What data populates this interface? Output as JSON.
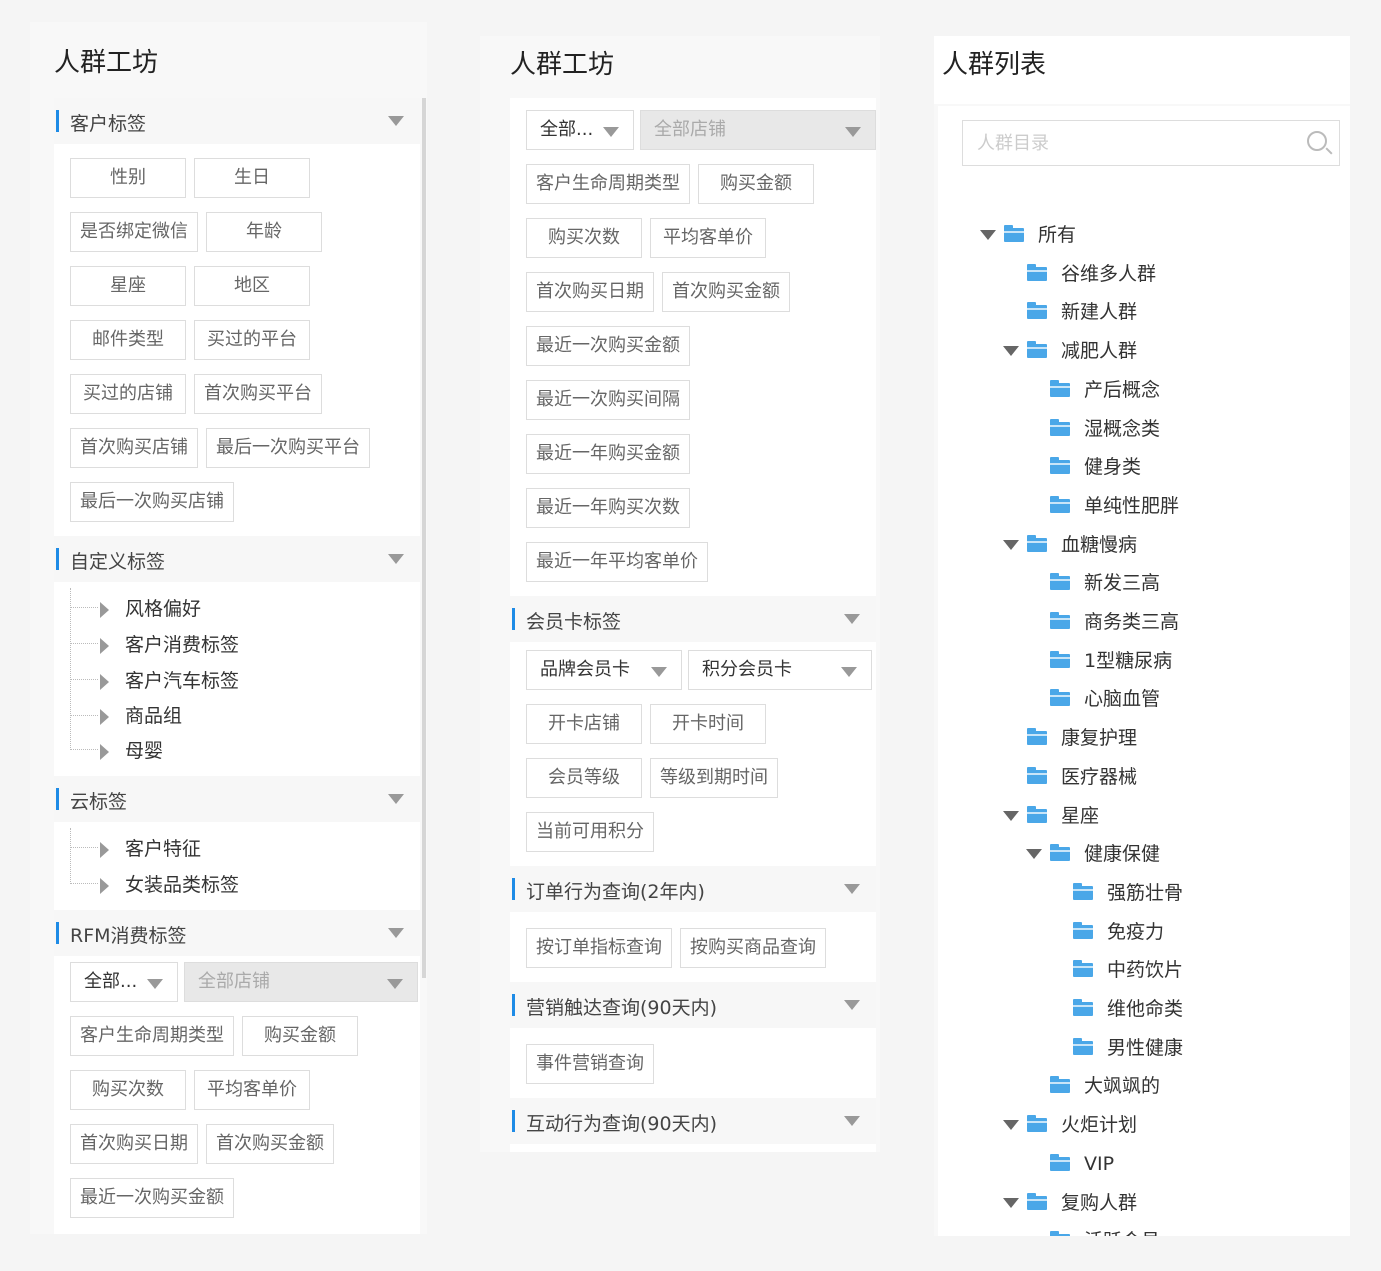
{
  "panel1": {
    "title": "人群工坊",
    "sections": [
      {
        "label": "客户标签"
      },
      {
        "label": "自定义标签"
      },
      {
        "label": "云标签"
      },
      {
        "label": "RFM消费标签"
      }
    ],
    "customer_tags": [
      "性别",
      "生日",
      "是否绑定微信",
      "年龄",
      "星座",
      "地区",
      "邮件类型",
      "买过的平台",
      "买过的店铺",
      "首次购买平台",
      "首次购买店铺",
      "最后一次购买平台",
      "最后一次购买店铺"
    ],
    "custom_tree": [
      "风格偏好",
      "客户消费标签",
      "客户汽车标签",
      "商品组",
      "母婴"
    ],
    "cloud_tree": [
      "客户特征",
      "女装品类标签"
    ],
    "rfm_select_all": "全部...",
    "rfm_select_store": "全部店铺",
    "rfm_tags": [
      "客户生命周期类型",
      "购买金额",
      "购买次数",
      "平均客单价",
      "首次购买日期",
      "首次购买金额",
      "最近一次购买金额"
    ]
  },
  "panel2": {
    "title": "人群工坊",
    "select_all": "全部...",
    "select_store": "全部店铺",
    "rfm_tags": [
      "客户生命周期类型",
      "购买金额",
      "购买次数",
      "平均客单价",
      "首次购买日期",
      "首次购买金额",
      "最近一次购买金额",
      "最近一次购买间隔",
      "最近一年购买金额",
      "最近一年购买次数",
      "最近一年平均客单价"
    ],
    "sections": [
      {
        "label": "会员卡标签"
      },
      {
        "label": "订单行为查询(2年内)"
      },
      {
        "label": "营销触达查询(90天内)"
      },
      {
        "label": "互动行为查询(90天内)"
      }
    ],
    "member_selects": [
      "品牌会员卡",
      "积分会员卡"
    ],
    "member_tags": [
      "开卡店铺",
      "开卡时间",
      "会员等级",
      "等级到期时间",
      "当前可用积分"
    ],
    "order_tags": [
      "按订单指标查询",
      "按购买商品查询"
    ],
    "marketing_tags": [
      "事件营销查询"
    ]
  },
  "panel3": {
    "title": "人群列表",
    "search_placeholder": "人群目录",
    "tree": [
      {
        "label": "所有",
        "level": 0,
        "expanded": true
      },
      {
        "label": "谷维多人群",
        "level": 1
      },
      {
        "label": "新建人群",
        "level": 1
      },
      {
        "label": "减肥人群",
        "level": 1,
        "expanded": true
      },
      {
        "label": "产后概念",
        "level": 2
      },
      {
        "label": "湿概念类",
        "level": 2
      },
      {
        "label": "健身类",
        "level": 2
      },
      {
        "label": "单纯性肥胖",
        "level": 2
      },
      {
        "label": "血糖慢病",
        "level": 1,
        "expanded": true
      },
      {
        "label": "新发三高",
        "level": 2
      },
      {
        "label": "商务类三高",
        "level": 2
      },
      {
        "label": "1型糖尿病",
        "level": 2
      },
      {
        "label": "心脑血管",
        "level": 2
      },
      {
        "label": "康复护理",
        "level": 1
      },
      {
        "label": "医疗器械",
        "level": 1
      },
      {
        "label": "星座",
        "level": 1,
        "expanded": true
      },
      {
        "label": "健康保健",
        "level": 2,
        "expanded": true
      },
      {
        "label": "强筋壮骨",
        "level": 3
      },
      {
        "label": "免疫力",
        "level": 3
      },
      {
        "label": "中药饮片",
        "level": 3
      },
      {
        "label": "维他命类",
        "level": 3
      },
      {
        "label": "男性健康",
        "level": 3
      },
      {
        "label": "大飒飒的",
        "level": 2
      },
      {
        "label": "火炬计划",
        "level": 1,
        "expanded": true
      },
      {
        "label": "VIP",
        "level": 2
      },
      {
        "label": "复购人群",
        "level": 1,
        "expanded": true
      },
      {
        "label": "活跃会员",
        "level": 2
      }
    ]
  },
  "colors": {
    "accent": "#1e8be6",
    "folder": "#4aa7e8"
  }
}
